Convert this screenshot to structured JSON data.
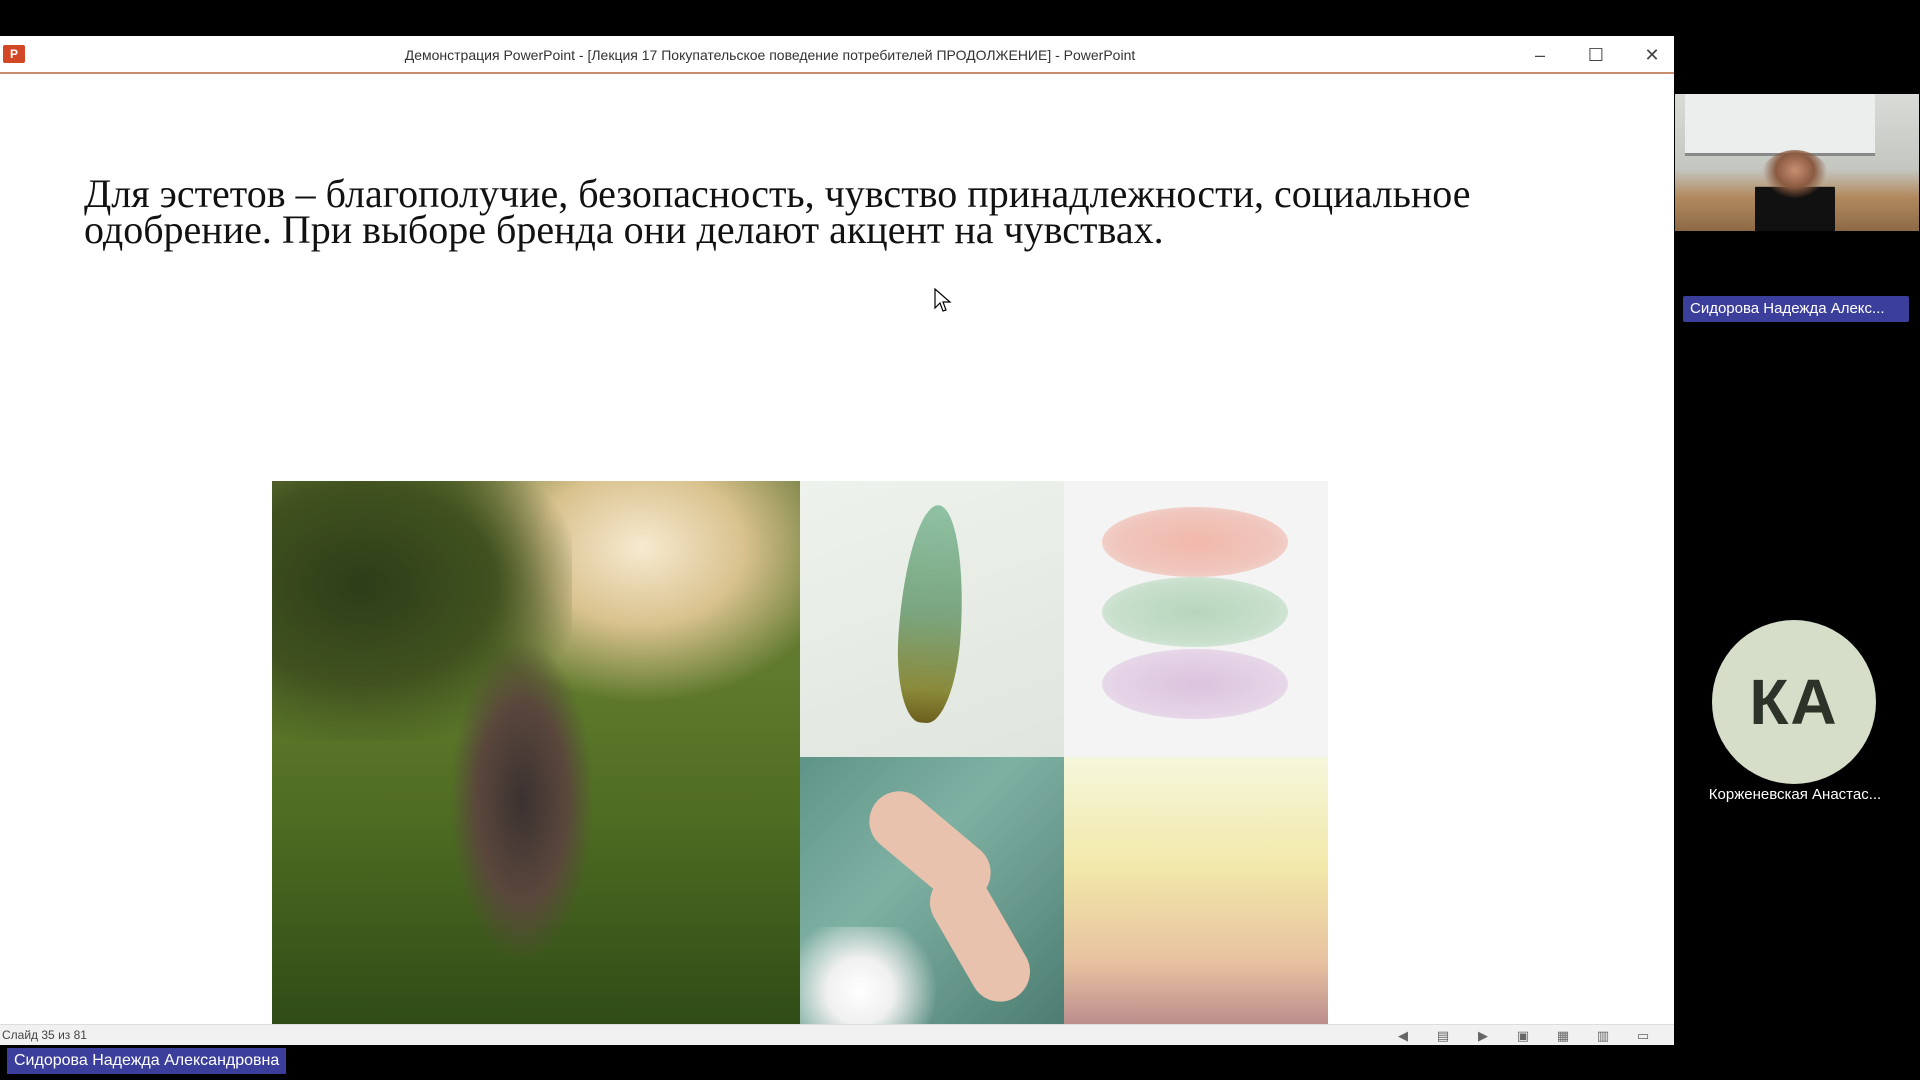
{
  "window": {
    "title": "Демонстрация PowerPoint - [Лекция 17 Покупательское поведение потребителей ПРОДОЛЖЕНИЕ] - PowerPoint",
    "app_icon": "P",
    "minimize": "–",
    "maximize": "☐",
    "close": "✕"
  },
  "slide": {
    "text": "Для эстетов – благополучие, безопасность, чувство принадлежности, социальное одобрение. При выборе бренда они делают акцент на чувствах."
  },
  "statusbar": {
    "slide_info": "Слайд 35 из 81"
  },
  "participants": {
    "presenter_name": "Сидорова Надежда Александровна",
    "video_name": "Сидорова Надежда Алекс...",
    "avatar_initials": "КА",
    "avatar_name": "Корженевская Анастас..."
  },
  "colors": {
    "name_tag_bg": "#3b3f9b",
    "titlebar_accent": "#c98e6e",
    "avatar_bg": "#d6ddc8"
  }
}
